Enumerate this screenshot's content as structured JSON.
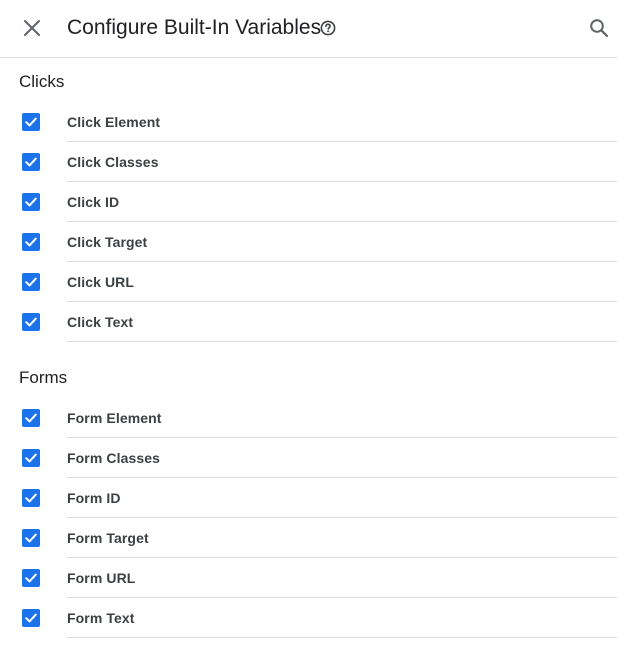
{
  "header": {
    "title": "Configure Built-In Variables"
  },
  "icons": {
    "close": "close-icon",
    "help": "help-circle-icon",
    "search": "search-icon",
    "check": "checkmark-icon"
  },
  "colors": {
    "accent": "#1a73e8",
    "divider": "#dadce0",
    "text": "#202124"
  },
  "sections": [
    {
      "title": "Clicks",
      "items": [
        {
          "label": "Click Element",
          "checked": true
        },
        {
          "label": "Click Classes",
          "checked": true
        },
        {
          "label": "Click ID",
          "checked": true
        },
        {
          "label": "Click Target",
          "checked": true
        },
        {
          "label": "Click URL",
          "checked": true
        },
        {
          "label": "Click Text",
          "checked": true
        }
      ]
    },
    {
      "title": "Forms",
      "items": [
        {
          "label": "Form Element",
          "checked": true
        },
        {
          "label": "Form Classes",
          "checked": true
        },
        {
          "label": "Form ID",
          "checked": true
        },
        {
          "label": "Form Target",
          "checked": true
        },
        {
          "label": "Form URL",
          "checked": true
        },
        {
          "label": "Form Text",
          "checked": true
        }
      ]
    }
  ]
}
